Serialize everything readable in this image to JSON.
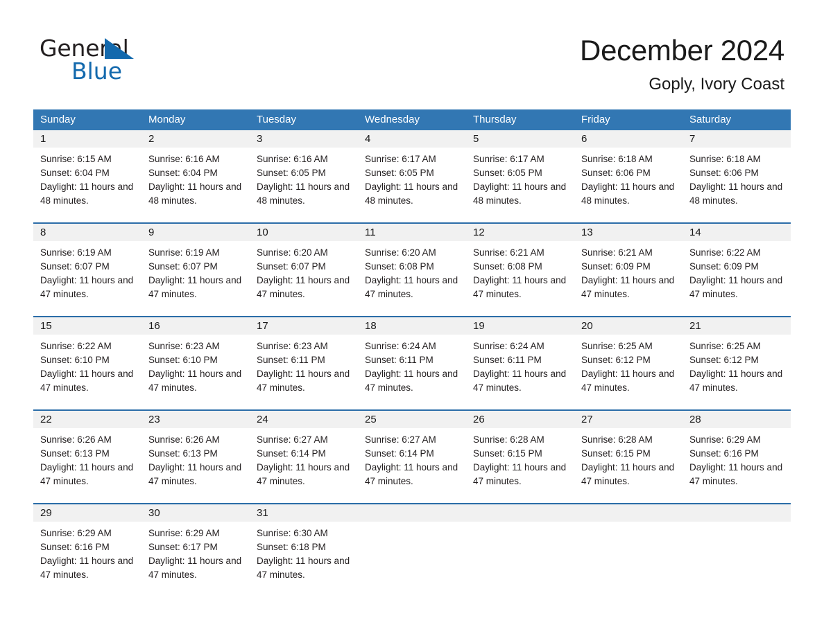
{
  "brand": {
    "name_part1": "General",
    "name_part2": "Blue",
    "accent_color": "#1369ad"
  },
  "header": {
    "title": "December 2024",
    "subtitle": "Goply, Ivory Coast"
  },
  "theme": {
    "header_blue": "#3277b3",
    "row_border_blue": "#2b6da8",
    "day_band_gray": "#f1f1f1"
  },
  "weekdays": [
    "Sunday",
    "Monday",
    "Tuesday",
    "Wednesday",
    "Thursday",
    "Friday",
    "Saturday"
  ],
  "weeks": [
    [
      {
        "day": "1",
        "sunrise": "Sunrise: 6:15 AM",
        "sunset": "Sunset: 6:04 PM",
        "daylight": "Daylight: 11 hours and 48 minutes."
      },
      {
        "day": "2",
        "sunrise": "Sunrise: 6:16 AM",
        "sunset": "Sunset: 6:04 PM",
        "daylight": "Daylight: 11 hours and 48 minutes."
      },
      {
        "day": "3",
        "sunrise": "Sunrise: 6:16 AM",
        "sunset": "Sunset: 6:05 PM",
        "daylight": "Daylight: 11 hours and 48 minutes."
      },
      {
        "day": "4",
        "sunrise": "Sunrise: 6:17 AM",
        "sunset": "Sunset: 6:05 PM",
        "daylight": "Daylight: 11 hours and 48 minutes."
      },
      {
        "day": "5",
        "sunrise": "Sunrise: 6:17 AM",
        "sunset": "Sunset: 6:05 PM",
        "daylight": "Daylight: 11 hours and 48 minutes."
      },
      {
        "day": "6",
        "sunrise": "Sunrise: 6:18 AM",
        "sunset": "Sunset: 6:06 PM",
        "daylight": "Daylight: 11 hours and 48 minutes."
      },
      {
        "day": "7",
        "sunrise": "Sunrise: 6:18 AM",
        "sunset": "Sunset: 6:06 PM",
        "daylight": "Daylight: 11 hours and 48 minutes."
      }
    ],
    [
      {
        "day": "8",
        "sunrise": "Sunrise: 6:19 AM",
        "sunset": "Sunset: 6:07 PM",
        "daylight": "Daylight: 11 hours and 47 minutes."
      },
      {
        "day": "9",
        "sunrise": "Sunrise: 6:19 AM",
        "sunset": "Sunset: 6:07 PM",
        "daylight": "Daylight: 11 hours and 47 minutes."
      },
      {
        "day": "10",
        "sunrise": "Sunrise: 6:20 AM",
        "sunset": "Sunset: 6:07 PM",
        "daylight": "Daylight: 11 hours and 47 minutes."
      },
      {
        "day": "11",
        "sunrise": "Sunrise: 6:20 AM",
        "sunset": "Sunset: 6:08 PM",
        "daylight": "Daylight: 11 hours and 47 minutes."
      },
      {
        "day": "12",
        "sunrise": "Sunrise: 6:21 AM",
        "sunset": "Sunset: 6:08 PM",
        "daylight": "Daylight: 11 hours and 47 minutes."
      },
      {
        "day": "13",
        "sunrise": "Sunrise: 6:21 AM",
        "sunset": "Sunset: 6:09 PM",
        "daylight": "Daylight: 11 hours and 47 minutes."
      },
      {
        "day": "14",
        "sunrise": "Sunrise: 6:22 AM",
        "sunset": "Sunset: 6:09 PM",
        "daylight": "Daylight: 11 hours and 47 minutes."
      }
    ],
    [
      {
        "day": "15",
        "sunrise": "Sunrise: 6:22 AM",
        "sunset": "Sunset: 6:10 PM",
        "daylight": "Daylight: 11 hours and 47 minutes."
      },
      {
        "day": "16",
        "sunrise": "Sunrise: 6:23 AM",
        "sunset": "Sunset: 6:10 PM",
        "daylight": "Daylight: 11 hours and 47 minutes."
      },
      {
        "day": "17",
        "sunrise": "Sunrise: 6:23 AM",
        "sunset": "Sunset: 6:11 PM",
        "daylight": "Daylight: 11 hours and 47 minutes."
      },
      {
        "day": "18",
        "sunrise": "Sunrise: 6:24 AM",
        "sunset": "Sunset: 6:11 PM",
        "daylight": "Daylight: 11 hours and 47 minutes."
      },
      {
        "day": "19",
        "sunrise": "Sunrise: 6:24 AM",
        "sunset": "Sunset: 6:11 PM",
        "daylight": "Daylight: 11 hours and 47 minutes."
      },
      {
        "day": "20",
        "sunrise": "Sunrise: 6:25 AM",
        "sunset": "Sunset: 6:12 PM",
        "daylight": "Daylight: 11 hours and 47 minutes."
      },
      {
        "day": "21",
        "sunrise": "Sunrise: 6:25 AM",
        "sunset": "Sunset: 6:12 PM",
        "daylight": "Daylight: 11 hours and 47 minutes."
      }
    ],
    [
      {
        "day": "22",
        "sunrise": "Sunrise: 6:26 AM",
        "sunset": "Sunset: 6:13 PM",
        "daylight": "Daylight: 11 hours and 47 minutes."
      },
      {
        "day": "23",
        "sunrise": "Sunrise: 6:26 AM",
        "sunset": "Sunset: 6:13 PM",
        "daylight": "Daylight: 11 hours and 47 minutes."
      },
      {
        "day": "24",
        "sunrise": "Sunrise: 6:27 AM",
        "sunset": "Sunset: 6:14 PM",
        "daylight": "Daylight: 11 hours and 47 minutes."
      },
      {
        "day": "25",
        "sunrise": "Sunrise: 6:27 AM",
        "sunset": "Sunset: 6:14 PM",
        "daylight": "Daylight: 11 hours and 47 minutes."
      },
      {
        "day": "26",
        "sunrise": "Sunrise: 6:28 AM",
        "sunset": "Sunset: 6:15 PM",
        "daylight": "Daylight: 11 hours and 47 minutes."
      },
      {
        "day": "27",
        "sunrise": "Sunrise: 6:28 AM",
        "sunset": "Sunset: 6:15 PM",
        "daylight": "Daylight: 11 hours and 47 minutes."
      },
      {
        "day": "28",
        "sunrise": "Sunrise: 6:29 AM",
        "sunset": "Sunset: 6:16 PM",
        "daylight": "Daylight: 11 hours and 47 minutes."
      }
    ],
    [
      {
        "day": "29",
        "sunrise": "Sunrise: 6:29 AM",
        "sunset": "Sunset: 6:16 PM",
        "daylight": "Daylight: 11 hours and 47 minutes."
      },
      {
        "day": "30",
        "sunrise": "Sunrise: 6:29 AM",
        "sunset": "Sunset: 6:17 PM",
        "daylight": "Daylight: 11 hours and 47 minutes."
      },
      {
        "day": "31",
        "sunrise": "Sunrise: 6:30 AM",
        "sunset": "Sunset: 6:18 PM",
        "daylight": "Daylight: 11 hours and 47 minutes."
      },
      {
        "day": "",
        "sunrise": "",
        "sunset": "",
        "daylight": ""
      },
      {
        "day": "",
        "sunrise": "",
        "sunset": "",
        "daylight": ""
      },
      {
        "day": "",
        "sunrise": "",
        "sunset": "",
        "daylight": ""
      },
      {
        "day": "",
        "sunrise": "",
        "sunset": "",
        "daylight": ""
      }
    ]
  ]
}
